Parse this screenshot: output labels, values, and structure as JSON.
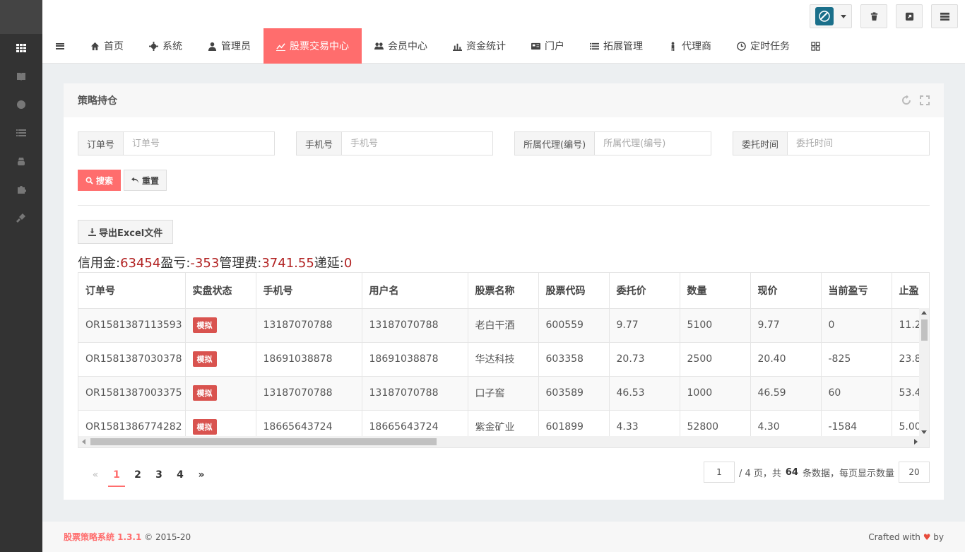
{
  "header": {
    "tools": [
      "brand-menu",
      "trash",
      "external-link",
      "settings-list"
    ]
  },
  "nav": {
    "items": [
      {
        "label": "首页",
        "icon": "home-icon"
      },
      {
        "label": "系统",
        "icon": "gear-icon"
      },
      {
        "label": "管理员",
        "icon": "user-icon"
      },
      {
        "label": "股票交易中心",
        "icon": "line-chart-icon",
        "active": true
      },
      {
        "label": "会员中心",
        "icon": "users-icon"
      },
      {
        "label": "资金统计",
        "icon": "bar-chart-icon"
      },
      {
        "label": "门户",
        "icon": "newspaper-icon"
      },
      {
        "label": "拓展管理",
        "icon": "list-icon"
      },
      {
        "label": "代理商",
        "icon": "person-icon"
      },
      {
        "label": "定时任务",
        "icon": "clock-icon"
      }
    ]
  },
  "panel": {
    "title": "策略持仓"
  },
  "filters": [
    {
      "label": "订单号",
      "placeholder": "订单号"
    },
    {
      "label": "手机号",
      "placeholder": "手机号"
    },
    {
      "label": "所属代理(编号)",
      "placeholder": "所属代理(编号)"
    },
    {
      "label": "委托时间",
      "placeholder": "委托时间"
    }
  ],
  "actions": {
    "search": "搜索",
    "reset": "重置",
    "export": "导出Excel文件"
  },
  "summary": {
    "credit_label": "信用金:",
    "credit": "63454",
    "pnl_label": "盈亏:",
    "pnl": "-353",
    "fee_label": "管理费:",
    "fee": "3741.55",
    "defer_label": "递延:",
    "defer": "0"
  },
  "table": {
    "columns": [
      "订单号",
      "实盘状态",
      "手机号",
      "用户名",
      "股票名称",
      "股票代码",
      "委托价",
      "数量",
      "现价",
      "当前盈亏",
      "止盈"
    ],
    "rows": [
      [
        "OR1581387113593",
        "模拟",
        "13187070788",
        "13187070788",
        "老白干酒",
        "600559",
        "9.77",
        "5100",
        "9.77",
        "0",
        "11.2"
      ],
      [
        "OR1581387030378",
        "模拟",
        "18691038878",
        "18691038878",
        "华达科技",
        "603358",
        "20.73",
        "2500",
        "20.40",
        "-825",
        "23.8"
      ],
      [
        "OR1581387003375",
        "模拟",
        "13187070788",
        "13187070788",
        "口子窖",
        "603589",
        "46.53",
        "1000",
        "46.59",
        "60",
        "53.4"
      ],
      [
        "OR1581386774282",
        "模拟",
        "18665643724",
        "18665643724",
        "紫金矿业",
        "601899",
        "4.33",
        "52800",
        "4.30",
        "-1584",
        "5.00"
      ]
    ]
  },
  "pager": {
    "prev": "«",
    "pages": [
      "1",
      "2",
      "3",
      "4"
    ],
    "current": "1",
    "next": "»",
    "page_input": "1",
    "total_pages_text": "/ 4 页，共",
    "total_count": "64",
    "count_suffix": "条数据，每页显示数量",
    "per_page": "20"
  },
  "footer": {
    "brand": "股票策略系统 1.3.1",
    "copyright": "© 2015-20",
    "crafted": "Crafted with",
    "heart": "♥",
    "by": "by"
  },
  "colors": {
    "accent": "#ff6d6d",
    "sidebar": "#333333",
    "badge": "#d9534f",
    "summary_value": "#b22222"
  }
}
